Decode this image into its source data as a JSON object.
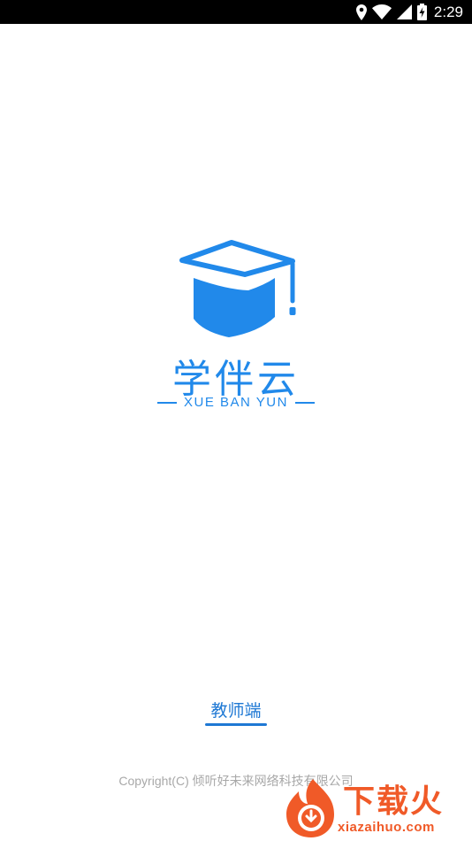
{
  "status_bar": {
    "time": "2:29",
    "icons": [
      "location-icon",
      "wifi-icon",
      "signal-icon",
      "battery-charging-icon"
    ]
  },
  "splash": {
    "app_name": "学伴云",
    "app_name_pinyin": "XUE BAN YUN",
    "brand_color": "#2189ea",
    "logo_icon": "graduation-cap-icon"
  },
  "role_selector": {
    "label": "教师端",
    "accent_color": "#1e78d4"
  },
  "footer": {
    "copyright": "Copyright(C)  倾听好未来网络科技有限公司"
  },
  "watermark": {
    "text": "下载火",
    "url": "xiazaihuo.com",
    "color": "#f05a28"
  }
}
